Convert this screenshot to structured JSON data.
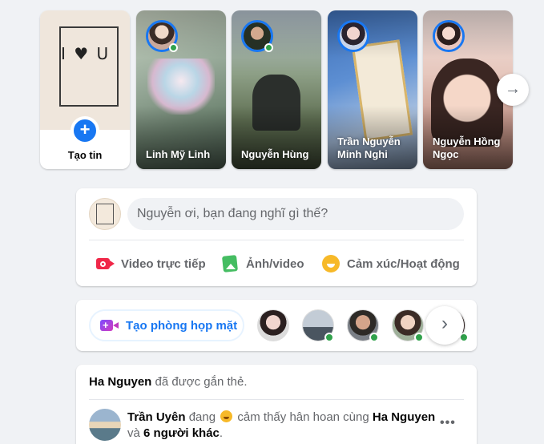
{
  "stories": {
    "create_label": "Tạo tin",
    "create_photo_text": "I ♥ U",
    "next_arrow": "→",
    "items": [
      {
        "name": "Linh Mỹ Linh",
        "online": true,
        "bg": "#8a9a7e"
      },
      {
        "name": "Nguyễn Hùng",
        "online": true,
        "bg": "#6f7f68"
      },
      {
        "name": "Trần Nguyễn Minh Nghi",
        "online": false,
        "bg": "#4d7fc4"
      },
      {
        "name": "Nguyễn Hồng Ngọc",
        "online": false,
        "bg": "#d8b4a8"
      }
    ]
  },
  "composer": {
    "placeholder": "Nguyễn ơi, bạn đang nghĩ gì thế?",
    "actions": [
      "Video trực tiếp",
      "Ảnh/video",
      "Cảm xúc/Hoạt động"
    ]
  },
  "rooms": {
    "create_label": "Tạo phòng họp mặt",
    "next_label": "›"
  },
  "post": {
    "tagger": "Ha Nguyen",
    "tag_text": " đã được gắn thẻ.",
    "author": "Trần Uyên",
    "doing": " đang ",
    "feeling": " cảm thấy hân hoan cùng ",
    "with": "Ha Nguyen",
    "and": "và ",
    "others": "6 người khác",
    "period": ".",
    "more": "•••"
  },
  "colors": {
    "accent": "#1877f2",
    "online": "#31a24c",
    "background": "#f0f2f5"
  }
}
